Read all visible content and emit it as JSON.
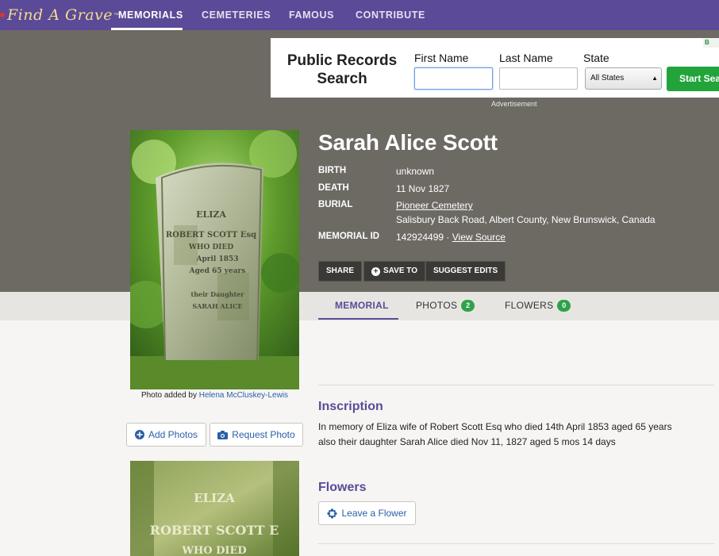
{
  "nav": {
    "logo": "Find A Grave",
    "logo_tm": "™",
    "items": [
      {
        "label": "MEMORIALS"
      },
      {
        "label": "CEMETERIES"
      },
      {
        "label": "FAMOUS"
      },
      {
        "label": "CONTRIBUTE"
      }
    ]
  },
  "ad": {
    "title": "Public Records Search",
    "first_name_label": "First Name",
    "last_name_label": "Last Name",
    "state_label": "State",
    "state_value": "All States",
    "button": "Start Search",
    "badge": "B",
    "caption": "Advertisement"
  },
  "memorial": {
    "name": "Sarah Alice Scott",
    "birth_label": "BIRTH",
    "birth_value": "unknown",
    "death_label": "DEATH",
    "death_value": "11 Nov 1827",
    "burial_label": "BURIAL",
    "burial_cemetery": "Pioneer Cemetery",
    "burial_location": "Salisbury Back Road, Albert County, New Brunswick, Canada",
    "id_label": "MEMORIAL ID",
    "id_value": "142924499 ·",
    "view_source": "View Source"
  },
  "actions": {
    "share": "SHARE",
    "save_to": "SAVE TO",
    "suggest_edits": "SUGGEST EDITS"
  },
  "tabs": {
    "memorial": "MEMORIAL",
    "photos": "PHOTOS",
    "photos_count": "2",
    "flowers": "FLOWERS",
    "flowers_count": "0"
  },
  "photo": {
    "caption_prefix": "Photo added by",
    "contributor": "Helena McCluskey-Lewis",
    "stone_lines": [
      "ELIZA",
      "ROBERT SCOTT Esq",
      "WHO DIED",
      "April 1853",
      "Aged 65 years",
      "their Daughter",
      "SARAH ALICE"
    ],
    "stone2_lines": [
      "ELIZA",
      "ROBERT SCOTT E",
      "WHO DIED"
    ]
  },
  "buttons": {
    "add_photos": "Add Photos",
    "request_photo": "Request Photo"
  },
  "inscription": {
    "heading": "Inscription",
    "line1": "In memory of Eliza wife of Robert Scott Esq who died 14th April 1853 aged 65 years",
    "line2": "also their daughter Sarah Alice died Nov 11, 1827 aged 5 mos 14 days"
  },
  "flowers": {
    "heading": "Flowers",
    "leave_button": "Leave a Flower"
  },
  "colors": {
    "brand_purple": "#5b4a97",
    "hero_grey": "#6d6a64",
    "badge_green": "#2ea24b",
    "ad_green": "#22a43b",
    "link_blue": "#2a5fa6"
  }
}
